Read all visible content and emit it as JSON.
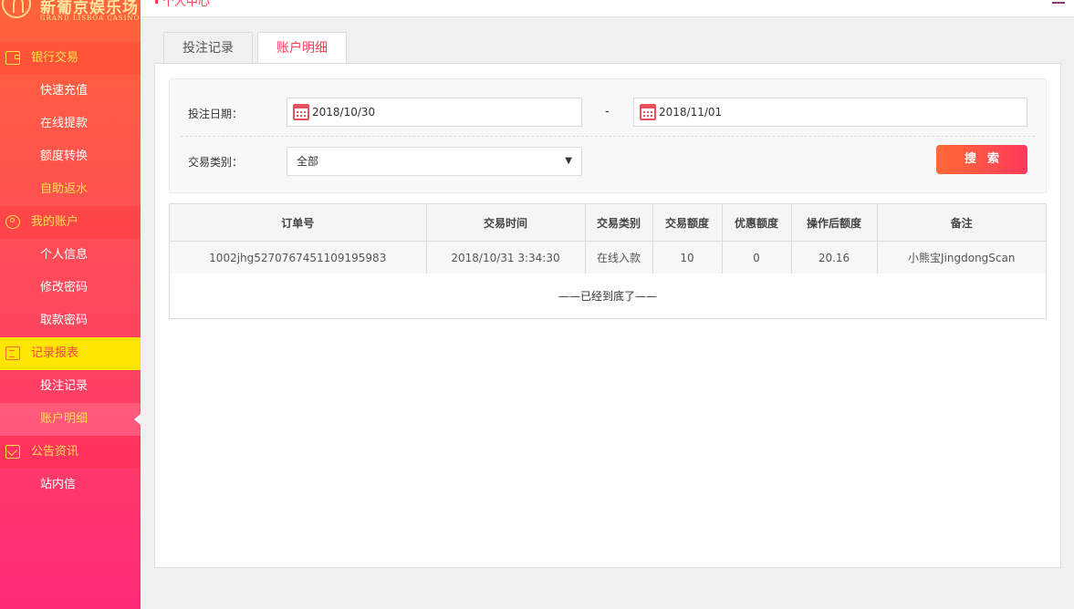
{
  "logo": {
    "name": "新葡京娱乐场",
    "sub": "GRAND LISBOA CASINO"
  },
  "header": {
    "crumb": "个人中心"
  },
  "sidebar": {
    "groups": [
      {
        "label": "银行交易",
        "icon": "wallet-icon",
        "items": [
          "快速充值",
          "在线提款",
          "额度转换",
          "自助返水"
        ]
      },
      {
        "label": "我的账户",
        "icon": "user-icon",
        "items": [
          "个人信息",
          "修改密码",
          "取款密码"
        ]
      },
      {
        "label": "记录报表",
        "icon": "report-icon",
        "items": [
          "投注记录",
          "账户明细"
        ]
      },
      {
        "label": "公告资讯",
        "icon": "mail-icon",
        "items": [
          "站内信"
        ]
      }
    ]
  },
  "tabs": [
    "投注记录",
    "账户明细"
  ],
  "filter": {
    "date_label": "投注日期：",
    "date_from": "2018/10/30",
    "date_sep": "-",
    "date_to": "2018/11/01",
    "type_label": "交易类别：",
    "type_value": "全部",
    "search_label": "搜索"
  },
  "table": {
    "headers": [
      "订单号",
      "交易时间",
      "交易类别",
      "交易额度",
      "优惠额度",
      "操作后额度",
      "备注"
    ],
    "rows": [
      [
        "1002jhg5270767451109195983",
        "2018/10/31 3:34:30",
        "在线入款",
        "10",
        "0",
        "20.16",
        "小熊宝JingdongScan"
      ]
    ],
    "end_note": "——已经到底了——"
  },
  "colors": {
    "accent": "#ff3e55",
    "highlight": "#ffe600"
  }
}
